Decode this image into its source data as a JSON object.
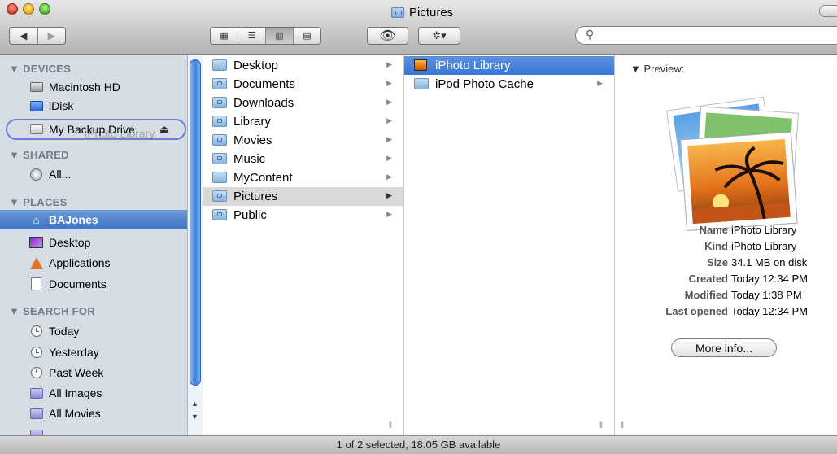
{
  "window": {
    "title": "Pictures"
  },
  "toolbar": {
    "back_glyph": "◀",
    "forward_glyph": "▶",
    "view_glyphs": [
      "▦",
      "☰",
      "▥",
      "▤"
    ],
    "quicklook_glyph": "👁",
    "action_glyph": "✲▾",
    "search_placeholder": "",
    "search_glyph": "⚲"
  },
  "sidebar": {
    "sections": {
      "devices": "▼ DEVICES",
      "shared": "▼ SHARED",
      "places": "▼ PLACES",
      "search": "▼ SEARCH FOR"
    },
    "devices": [
      "Macintosh HD",
      "iDisk",
      "My Backup Drive"
    ],
    "shared": [
      "All..."
    ],
    "places": [
      "BAJones",
      "Desktop",
      "Applications",
      "Documents"
    ],
    "search_for": [
      "Today",
      "Yesterday",
      "Past Week",
      "All Images",
      "All Movies"
    ],
    "drag_ghost": "iPhoto Library",
    "eject_glyph": "⏏"
  },
  "column1": {
    "items": [
      "Desktop",
      "Documents",
      "Downloads",
      "Library",
      "Movies",
      "Music",
      "MyContent",
      "Pictures",
      "Public"
    ],
    "selected": "Pictures"
  },
  "column2": {
    "items": [
      "iPhoto Library",
      "iPod Photo Cache"
    ],
    "selected": "iPhoto Library"
  },
  "preview": {
    "heading": "▼ Preview:",
    "fields": [
      {
        "key": "Name",
        "value": "iPhoto Library"
      },
      {
        "key": "Kind",
        "value": "iPhoto Library"
      },
      {
        "key": "Size",
        "value": "34.1 MB on disk"
      },
      {
        "key": "Created",
        "value": "Today 12:34 PM"
      },
      {
        "key": "Modified",
        "value": "Today 1:38 PM"
      },
      {
        "key": "Last opened",
        "value": "Today 12:34 PM"
      }
    ],
    "more_info": "More info..."
  },
  "status": {
    "text": "1 of 2 selected, 18.05 GB available"
  },
  "colors": {
    "selection": "#3a76d6",
    "sidebar_bg": "#d6dde5",
    "drop_outline": "#6c7fd8"
  }
}
